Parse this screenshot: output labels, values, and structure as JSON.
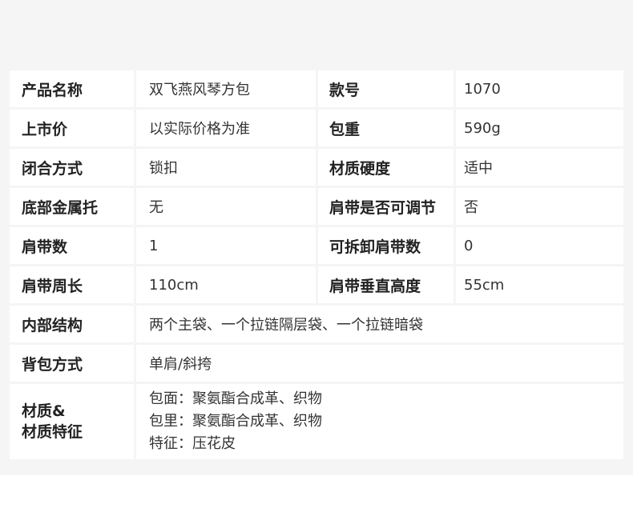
{
  "rows": [
    {
      "label": "产品名称",
      "value": "双飞燕风琴方包",
      "label2": "款号",
      "value2": "1070"
    },
    {
      "label": "上市价",
      "value": "以实际价格为准",
      "label2": "包重",
      "value2": "590g"
    },
    {
      "label": "闭合方式",
      "value": "锁扣",
      "label2": "材质硬度",
      "value2": "适中"
    },
    {
      "label": "底部金属托",
      "value": "无",
      "label2": "肩带是否可调节",
      "value2": "否"
    },
    {
      "label": "肩带数",
      "value": "1",
      "label2": "可拆卸肩带数",
      "value2": "0"
    },
    {
      "label": "肩带周长",
      "value": "110cm",
      "label2": "肩带垂直高度",
      "value2": "55cm"
    }
  ],
  "internal": {
    "label": "内部结构",
    "value": "两个主袋、一个拉链隔层袋、一个拉链暗袋"
  },
  "carry": {
    "label": "背包方式",
    "value": "单肩/斜挎"
  },
  "material": {
    "label_line1": "材质&",
    "label_line2": "材质特征",
    "lines": [
      "包面：聚氨酯合成革、织物",
      "包里：聚氨酯合成革、织物",
      "特征：压花皮"
    ]
  }
}
